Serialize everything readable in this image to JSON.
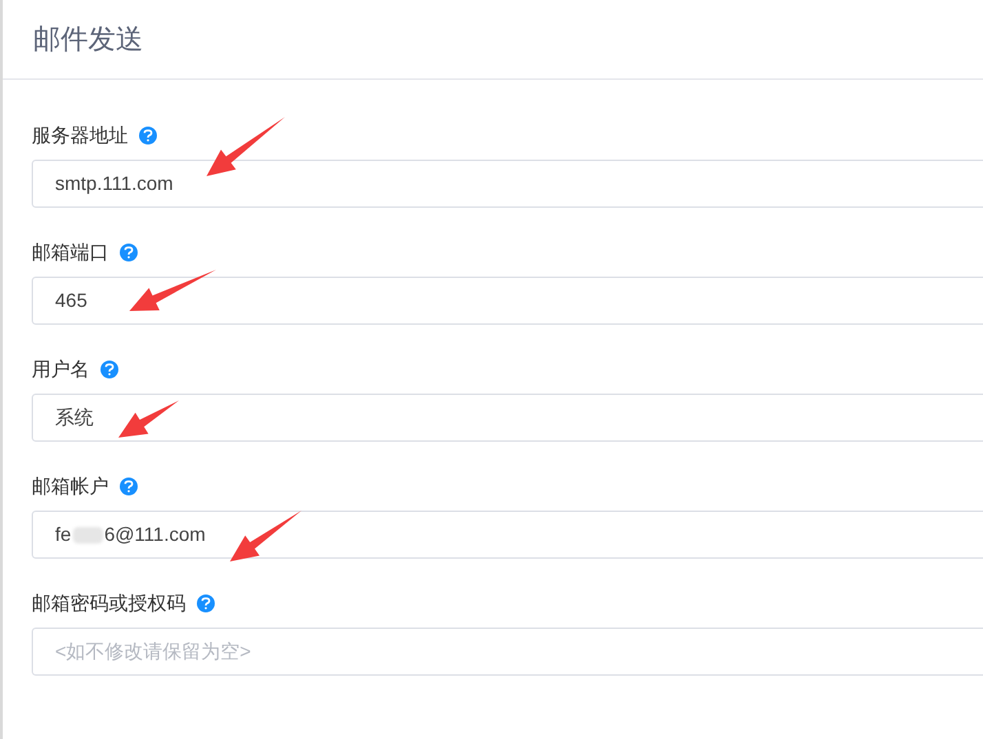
{
  "title": "邮件发送",
  "fields": [
    {
      "label": "服务器地址",
      "value": "smtp.111.com",
      "annotated": true
    },
    {
      "label": "邮箱端口",
      "value": "465",
      "annotated": true
    },
    {
      "label": "用户名",
      "value": "系统",
      "annotated": true
    },
    {
      "label": "邮箱帐户",
      "value": "fe",
      "value_end": "6@111.com",
      "redacted": true,
      "annotated": true
    },
    {
      "label": "邮箱密码或授权码",
      "placeholder": "<如不修改请保留为空>",
      "annotated": false
    }
  ]
}
